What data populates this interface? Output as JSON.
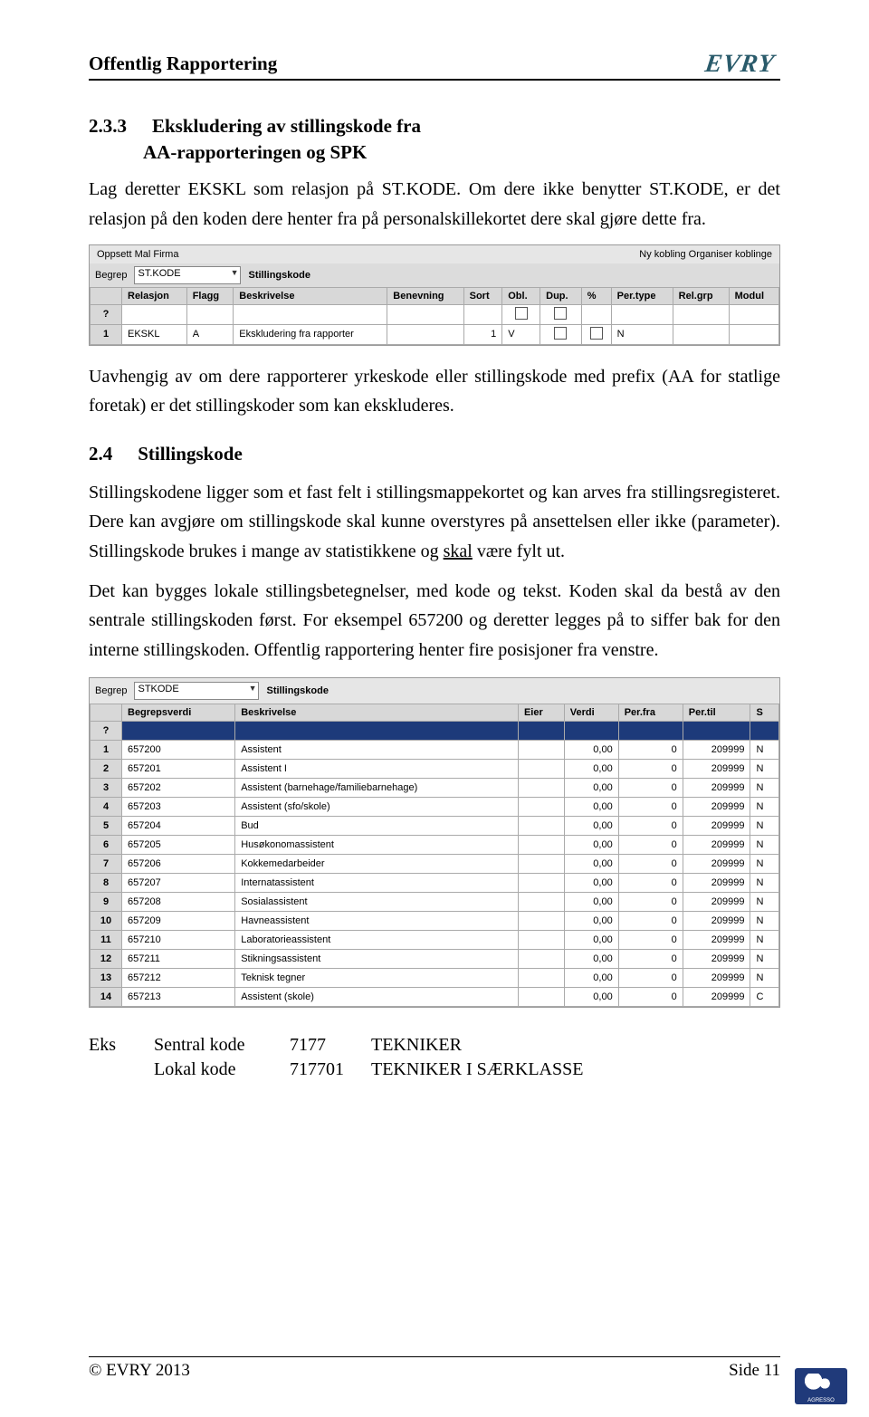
{
  "header": {
    "title": "Offentlig Rapportering",
    "logo": "EVRY"
  },
  "sec233": {
    "num": "2.3.3",
    "title_line1": "Ekskludering av stillingskode fra",
    "title_line2": "AA-rapporteringen og SPK",
    "p1": "Lag deretter EKSKL som relasjon på ST.KODE. Om dere ikke benytter ST.KODE, er det relasjon på den koden dere henter fra på personalskillekortet dere skal gjøre dette fra.",
    "p2": "Uavhengig av om dere rapporterer yrkeskode eller stillingskode med prefix (AA for statlige foretak) er det stillingskoder som kan ekskluderes."
  },
  "ui1": {
    "menu_left": "Oppsett  Mal  Firma",
    "menu_right": "Ny kobling  Organiser koblinge",
    "begrep_label": "Begrep",
    "begrep_value": "ST.KODE",
    "begrep_title": "Stillingskode",
    "cols": [
      "",
      "Relasjon",
      "Flagg",
      "Beskrivelse",
      "Benevning",
      "Sort",
      "Obl.",
      "Dup.",
      "%",
      "Per.type",
      "Rel.grp",
      "Modul"
    ],
    "qrow": "?",
    "row": {
      "n": "1",
      "relasjon": "EKSKL",
      "flagg": "A",
      "beskrivelse": "Ekskludering fra rapporter",
      "benevning": "",
      "sort": "1",
      "obl": "V",
      "pct": "N"
    }
  },
  "sec24": {
    "num": "2.4",
    "title": "Stillingskode",
    "p1": "Stillingskodene ligger som et fast felt i stillingsmappekortet og kan arves fra stillingsregisteret. Dere kan avgjøre om stillingskode skal kunne overstyres på ansettelsen eller ikke (parameter). Stillingskode brukes i mange av statistikkene og ",
    "p1_u": "skal",
    "p1_after": " være fylt ut.",
    "p2": "Det kan bygges lokale stillingsbetegnelser, med kode og tekst. Koden skal da bestå av den sentrale stillingskoden først. For eksempel 657200 og deretter legges på to siffer bak for den interne stillingskoden. Offentlig rapportering henter fire posisjoner fra venstre."
  },
  "ui2": {
    "begrep_label": "Begrep",
    "begrep_value": "STKODE",
    "begrep_title": "Stillingskode",
    "cols": [
      "",
      "Begrepsverdi",
      "Beskrivelse",
      "Eier",
      "Verdi",
      "Per.fra",
      "Per.til",
      "S"
    ],
    "qrow": "?",
    "rows": [
      {
        "n": "1",
        "v": "657200",
        "b": "Assistent",
        "e": "",
        "val": "0,00",
        "pf": "0",
        "pt": "209999",
        "s": "N"
      },
      {
        "n": "2",
        "v": "657201",
        "b": "Assistent I",
        "e": "",
        "val": "0,00",
        "pf": "0",
        "pt": "209999",
        "s": "N"
      },
      {
        "n": "3",
        "v": "657202",
        "b": "Assistent (barnehage/familiebarnehage)",
        "e": "",
        "val": "0,00",
        "pf": "0",
        "pt": "209999",
        "s": "N"
      },
      {
        "n": "4",
        "v": "657203",
        "b": "Assistent (sfo/skole)",
        "e": "",
        "val": "0,00",
        "pf": "0",
        "pt": "209999",
        "s": "N"
      },
      {
        "n": "5",
        "v": "657204",
        "b": "Bud",
        "e": "",
        "val": "0,00",
        "pf": "0",
        "pt": "209999",
        "s": "N"
      },
      {
        "n": "6",
        "v": "657205",
        "b": "Husøkonomassistent",
        "e": "",
        "val": "0,00",
        "pf": "0",
        "pt": "209999",
        "s": "N"
      },
      {
        "n": "7",
        "v": "657206",
        "b": "Kokkemedarbeider",
        "e": "",
        "val": "0,00",
        "pf": "0",
        "pt": "209999",
        "s": "N"
      },
      {
        "n": "8",
        "v": "657207",
        "b": "Internatassistent",
        "e": "",
        "val": "0,00",
        "pf": "0",
        "pt": "209999",
        "s": "N"
      },
      {
        "n": "9",
        "v": "657208",
        "b": "Sosialassistent",
        "e": "",
        "val": "0,00",
        "pf": "0",
        "pt": "209999",
        "s": "N"
      },
      {
        "n": "10",
        "v": "657209",
        "b": "Havneassistent",
        "e": "",
        "val": "0,00",
        "pf": "0",
        "pt": "209999",
        "s": "N"
      },
      {
        "n": "11",
        "v": "657210",
        "b": "Laboratorieassistent",
        "e": "",
        "val": "0,00",
        "pf": "0",
        "pt": "209999",
        "s": "N"
      },
      {
        "n": "12",
        "v": "657211",
        "b": "Stikningsassistent",
        "e": "",
        "val": "0,00",
        "pf": "0",
        "pt": "209999",
        "s": "N"
      },
      {
        "n": "13",
        "v": "657212",
        "b": "Teknisk tegner",
        "e": "",
        "val": "0,00",
        "pf": "0",
        "pt": "209999",
        "s": "N"
      },
      {
        "n": "14",
        "v": "657213",
        "b": "Assistent (skole)",
        "e": "",
        "val": "0,00",
        "pf": "0",
        "pt": "209999",
        "s": "C"
      }
    ]
  },
  "eks": {
    "label": "Eks",
    "r1": {
      "a": "Sentral kode",
      "b": "7177",
      "c": "TEKNIKER"
    },
    "r2": {
      "a": "Lokal kode",
      "b": "717701",
      "c": "TEKNIKER I SÆRKLASSE"
    }
  },
  "footer": {
    "left": "© EVRY 2013",
    "right": "Side 11",
    "badge": "AGRESSO"
  }
}
